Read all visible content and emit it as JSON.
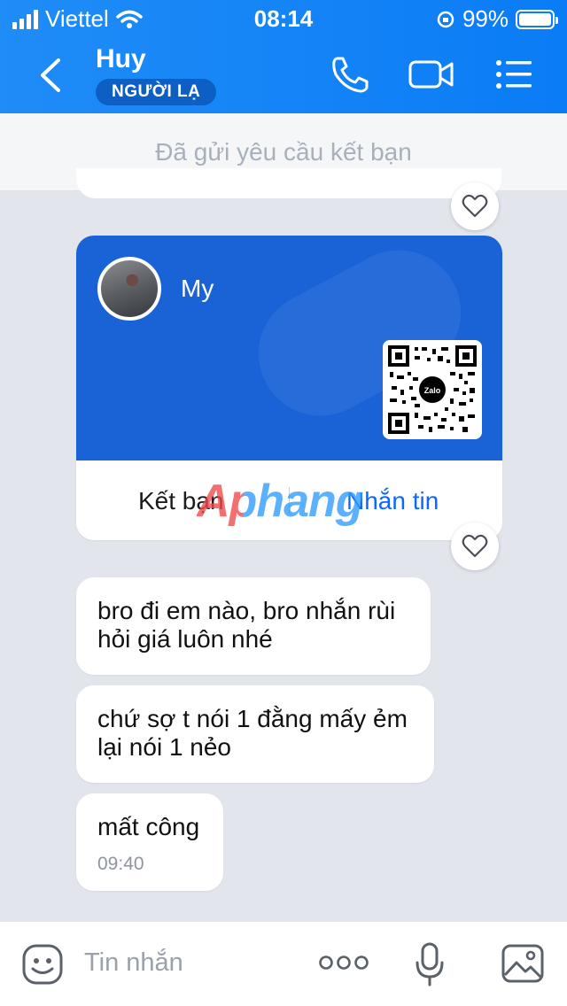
{
  "status_bar": {
    "carrier": "Viettel",
    "time": "08:14",
    "battery": "99%"
  },
  "header": {
    "name": "Huy",
    "badge": "NGƯỜI LẠ"
  },
  "friend_request": {
    "text": "Đã gửi yêu cầu kết bạn"
  },
  "card": {
    "name": "My",
    "add_label": "Kết bạn",
    "message_label": "Nhắn tin",
    "qr_logo": "Zalo"
  },
  "watermark": "Aphang",
  "messages": [
    {
      "text_line1": "bro đi em nào, bro nhắn rùi",
      "text_line2": "hỏi giá luôn nhé"
    },
    {
      "text_line1": "chứ sợ t nói 1 đằng mấy ẻm",
      "text_line2": "lại nói 1 nẻo"
    },
    {
      "text_line1": "mất công",
      "time": "09:40"
    }
  ],
  "input": {
    "placeholder": "Tin nhắn"
  },
  "icons": [
    "back-icon",
    "phone-icon",
    "video-call-icon",
    "menu-icon",
    "heart-icon",
    "sticker-icon",
    "more-icon",
    "microphone-icon",
    "image-icon"
  ]
}
